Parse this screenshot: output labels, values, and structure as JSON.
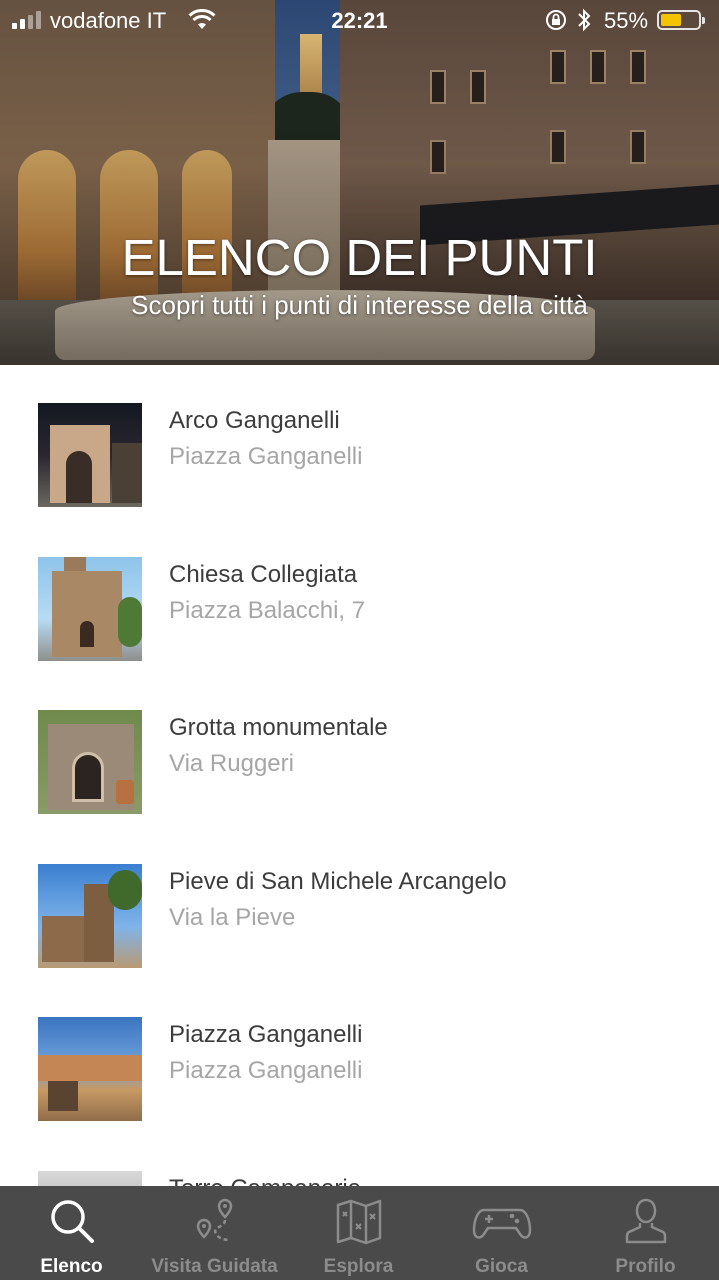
{
  "status_bar": {
    "carrier": "vodafone IT",
    "time": "22:21",
    "battery_percent": "55%",
    "battery_level": 0.55,
    "battery_color": "#f5c400"
  },
  "hero": {
    "title": "ELENCO DEI PUNTI",
    "subtitle": "Scopri tutti i punti di interesse della città"
  },
  "points": [
    {
      "title": "Arco Ganganelli",
      "address": "Piazza Ganganelli"
    },
    {
      "title": "Chiesa Collegiata",
      "address": "Piazza Balacchi, 7"
    },
    {
      "title": "Grotta monumentale",
      "address": "Via Ruggeri"
    },
    {
      "title": "Pieve di San Michele Arcangelo",
      "address": "Via la Pieve"
    },
    {
      "title": "Piazza Ganganelli",
      "address": "Piazza Ganganelli"
    },
    {
      "title": "Torre Campanaria",
      "address": ""
    }
  ],
  "tab_bar": {
    "active_color": "#ffffff",
    "inactive_color": "#8c8c8c",
    "background": "#4a4a4a",
    "tabs": [
      {
        "label": "Elenco",
        "icon": "search-icon",
        "active": true
      },
      {
        "label": "Visita Guidata",
        "icon": "route-pin-icon",
        "active": false
      },
      {
        "label": "Esplora",
        "icon": "map-icon",
        "active": false
      },
      {
        "label": "Gioca",
        "icon": "gamepad-icon",
        "active": false
      },
      {
        "label": "Profilo",
        "icon": "user-icon",
        "active": false
      }
    ]
  }
}
